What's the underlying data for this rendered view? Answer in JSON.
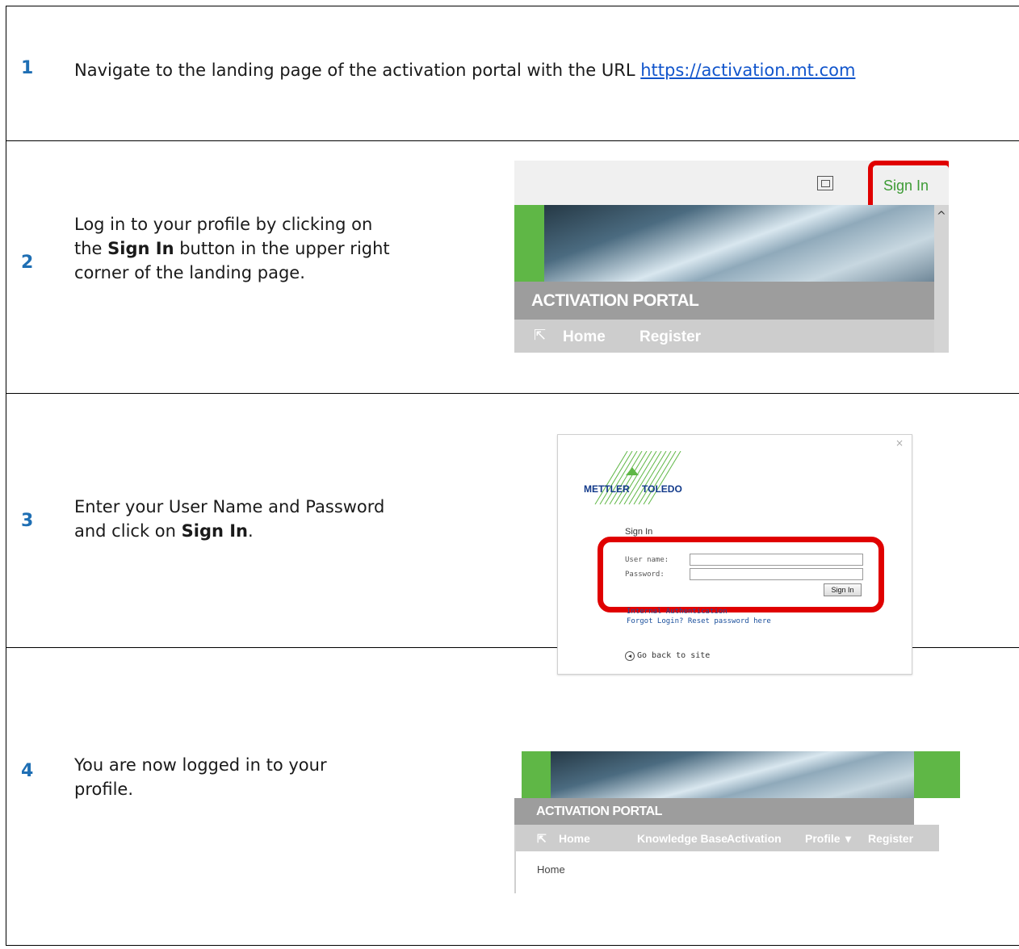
{
  "steps": [
    {
      "number": "1",
      "text_before": "Navigate to the landing page of the activation portal with the URL ",
      "link": "https://activation.mt.com"
    },
    {
      "number": "2",
      "text_line1": "Log in to your profile by clicking on",
      "text_line2_before": "the ",
      "text_line2_bold": "Sign In",
      "text_line2_after": " button in the upper right",
      "text_line3": "corner of the landing page."
    },
    {
      "number": "3",
      "text_line1": "Enter your User Name and Password",
      "text_line2_before": "and click on ",
      "text_line2_bold": "Sign In",
      "text_line2_after": "."
    },
    {
      "number": "4",
      "text_line1": "You are now logged in to your",
      "text_line2": "profile."
    }
  ],
  "screenshot2": {
    "signin_label": "Sign In",
    "portal_title": "ACTIVATION PORTAL",
    "nav": [
      "Home",
      "Register"
    ],
    "highlight_color": "#e00000",
    "accent_green": "#5fb746"
  },
  "screenshot3": {
    "brand_left": "METTLER",
    "brand_right": "TOLEDO",
    "title": "Sign In",
    "username_label": "User name:",
    "password_label": "Password:",
    "button_label": "Sign In",
    "internal_auth": "Internal Authentication",
    "forgot": "Forgot Login? Reset password here",
    "back": "Go back to site",
    "close": "×"
  },
  "screenshot4": {
    "portal_title": "ACTIVATION PORTAL",
    "nav": [
      "Home",
      "Knowledge Base",
      "Activation",
      "Profile",
      "Register"
    ],
    "breadcrumb": "Home"
  }
}
